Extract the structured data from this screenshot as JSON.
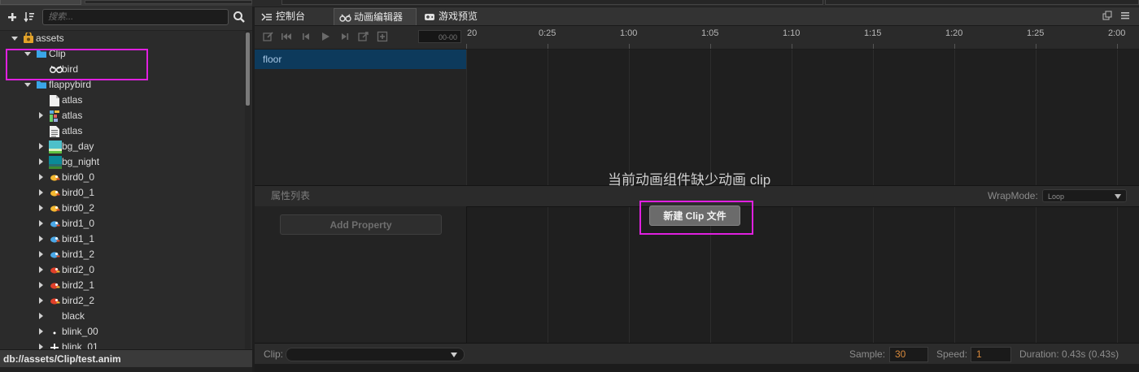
{
  "assets_panel": {
    "search_placeholder": "搜索...",
    "tree": [
      {
        "label": "assets",
        "indent": 0,
        "expand": "down",
        "icon": "db-icon"
      },
      {
        "label": "Clip",
        "indent": 1,
        "expand": "down",
        "icon": "folder-icon"
      },
      {
        "label": "bird",
        "indent": 2,
        "expand": "none",
        "icon": "animation-clip-icon"
      },
      {
        "label": "flappybird",
        "indent": 1,
        "expand": "down",
        "icon": "folder-icon"
      },
      {
        "label": "atlas",
        "indent": 2,
        "expand": "none",
        "icon": "file-icon"
      },
      {
        "label": "atlas",
        "indent": 2,
        "expand": "right",
        "icon": "sprite-atlas-icon"
      },
      {
        "label": "atlas",
        "indent": 2,
        "expand": "none",
        "icon": "text-file-icon"
      },
      {
        "label": "bg_day",
        "indent": 2,
        "expand": "right",
        "icon": "bg-day-thumbnail-icon"
      },
      {
        "label": "bg_night",
        "indent": 2,
        "expand": "right",
        "icon": "bg-night-thumbnail-icon"
      },
      {
        "label": "bird0_0",
        "indent": 2,
        "expand": "right",
        "icon": "bird-orange-icon"
      },
      {
        "label": "bird0_1",
        "indent": 2,
        "expand": "right",
        "icon": "bird-orange-icon"
      },
      {
        "label": "bird0_2",
        "indent": 2,
        "expand": "right",
        "icon": "bird-orange-icon"
      },
      {
        "label": "bird1_0",
        "indent": 2,
        "expand": "right",
        "icon": "bird-blue-icon"
      },
      {
        "label": "bird1_1",
        "indent": 2,
        "expand": "right",
        "icon": "bird-blue-icon"
      },
      {
        "label": "bird1_2",
        "indent": 2,
        "expand": "right",
        "icon": "bird-blue-icon"
      },
      {
        "label": "bird2_0",
        "indent": 2,
        "expand": "right",
        "icon": "bird-red-icon"
      },
      {
        "label": "bird2_1",
        "indent": 2,
        "expand": "right",
        "icon": "bird-red-icon"
      },
      {
        "label": "bird2_2",
        "indent": 2,
        "expand": "right",
        "icon": "bird-red-icon"
      },
      {
        "label": "black",
        "indent": 2,
        "expand": "right",
        "icon": "black-thumbnail-icon"
      },
      {
        "label": "blink_00",
        "indent": 2,
        "expand": "right",
        "icon": "dot-thumbnail-icon"
      },
      {
        "label": "blink_01",
        "indent": 2,
        "expand": "right",
        "icon": "sparkle-thumbnail-icon"
      }
    ],
    "status_path": "db://assets/Clip/test.anim"
  },
  "tabs": [
    {
      "label": "控制台",
      "icon": "console-icon",
      "active": false
    },
    {
      "label": "动画编辑器",
      "icon": "animation-editor-icon",
      "active": true
    },
    {
      "label": "游戏预览",
      "icon": "game-preview-icon",
      "active": false
    }
  ],
  "animation_editor": {
    "frame_display": "00-00",
    "ruler_ticks": [
      "20",
      "0:25",
      "1:00",
      "1:05",
      "1:10",
      "1:15",
      "1:20",
      "1:25",
      "2:00"
    ],
    "node_name": "floor",
    "property_list_title": "属性列表",
    "wrap_mode_label": "WrapMode:",
    "wrap_mode_value": "Loop",
    "add_property_label": "Add Property",
    "missing_clip_message": "当前动画组件缺少动画 clip",
    "new_clip_button": "新建 Clip 文件",
    "footer": {
      "clip_label": "Clip:",
      "clip_value": "",
      "sample_label": "Sample:",
      "sample_value": "30",
      "speed_label": "Speed:",
      "speed_value": "1",
      "duration_text": "Duration: 0.43s (0.43s)"
    }
  },
  "colors": {
    "highlight": "#e020e0",
    "selected_node": "#0d3a5c",
    "input_value": "#d8893c"
  }
}
